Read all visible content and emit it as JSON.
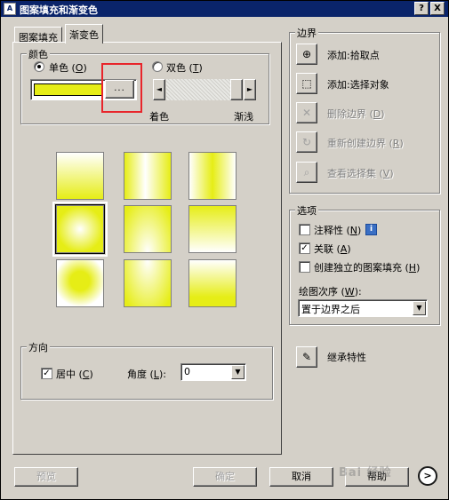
{
  "window": {
    "title": "图案填充和渐变色",
    "title_icon": "A",
    "help_btn": "?",
    "close_btn": "X"
  },
  "tabs": [
    {
      "label": "图案填充",
      "active": false
    },
    {
      "label": "渐变色",
      "active": true
    }
  ],
  "color_group": {
    "label": "颜色",
    "single": {
      "text": "单色 (",
      "key": "O",
      "close": ")",
      "selected": true
    },
    "dual": {
      "text": "双色 (",
      "key": "T",
      "close": ")",
      "selected": false
    },
    "swatch_color": "#e6ed16",
    "dots_label": "...",
    "slider_left": "◄",
    "slider_right": "►",
    "shade_label": "着色",
    "tint_label": "渐浅"
  },
  "gradient_patterns": [
    "linear-v-light-top",
    "cylinder-v",
    "inv-cylinder-v",
    "spherical",
    "hemispherical",
    "curved",
    "inv-spherical",
    "inv-hemispherical",
    "inv-curved"
  ],
  "selected_pattern_index": 3,
  "orientation_group": {
    "label": "方向",
    "centered_text": "居中 (",
    "centered_key": "C",
    "centered_close": ")",
    "centered_checked": true,
    "check_mark": "✓",
    "angle_text": "角度 (",
    "angle_key": "L",
    "angle_close": "):",
    "angle_value": "0",
    "combo_arrow": "▼"
  },
  "boundaries": {
    "label": "边界",
    "items": [
      {
        "text": "添加:拾取点",
        "icon": "pick-points-icon",
        "glyph": "⊕",
        "enabled": true
      },
      {
        "text": "添加:选择对象",
        "icon": "select-objects-icon",
        "glyph": "⬚",
        "enabled": true
      },
      {
        "text": "删除边界 (",
        "key": "D",
        "close": ")",
        "icon": "remove-boundaries-icon",
        "glyph": "✕",
        "enabled": false
      },
      {
        "text": "重新创建边界 (",
        "key": "R",
        "close": ")",
        "icon": "recreate-boundary-icon",
        "glyph": "↻",
        "enabled": false
      },
      {
        "text": "查看选择集 (",
        "key": "V",
        "close": ")",
        "icon": "view-selections-icon",
        "glyph": "⌕",
        "enabled": false
      }
    ]
  },
  "options": {
    "label": "选项",
    "annotative": {
      "text": "注释性 (",
      "key": "N",
      "close": ")",
      "checked": false,
      "info": "i"
    },
    "associative": {
      "text": "关联 (",
      "key": "A",
      "close": ")",
      "checked": true
    },
    "separate": {
      "text": "创建独立的图案填充 (",
      "key": "H",
      "close": ")",
      "checked": false
    },
    "draw_order_text": "绘图次序 (",
    "draw_order_key": "W",
    "draw_order_close": "):",
    "draw_order_value": "置于边界之后"
  },
  "inherit": {
    "label": "继承特性",
    "glyph": "✎"
  },
  "bottom": {
    "preview": "预览",
    "ok": "确定",
    "cancel": "取消",
    "help": "帮助",
    "more": ">"
  },
  "watermark": "Bai 经验",
  "colors": {
    "accent_yellow": "#e6ed16",
    "titlebar": "#0a246a",
    "dialog_face": "#d4d0c8",
    "highlight_box": "#e8252b"
  }
}
